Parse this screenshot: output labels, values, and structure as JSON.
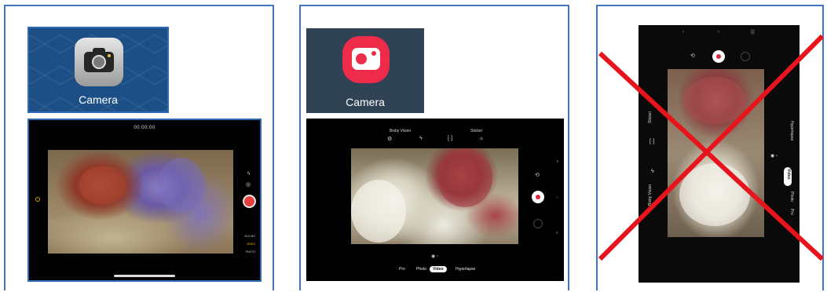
{
  "ios_panel": {
    "app_label": "Camera",
    "timer": "00:00:00",
    "modes": [
      "SLO-MO",
      "VIDEO",
      "PHOTO"
    ],
    "active_mode": "VIDEO"
  },
  "samsung_panel": {
    "app_label": "Camera",
    "top_labels": [
      "Bixby Vision",
      "Sticker"
    ],
    "modes": [
      "Pro",
      "Photo",
      "Video",
      "Hyperlapse"
    ],
    "active_mode": "Video"
  },
  "rotated_panel": {
    "side_labels": [
      "Sticker",
      "Bixby Vision"
    ],
    "modes": [
      "Hyperlapse",
      "Video",
      "Photo",
      "Pro"
    ],
    "active_mode": "Video",
    "crossed_out": true
  },
  "colors": {
    "panel_border": "#4472c4",
    "ios_shutter": "#e53e3e",
    "samsung_icon": "#ee2c4a",
    "cross": "#e8141b"
  }
}
